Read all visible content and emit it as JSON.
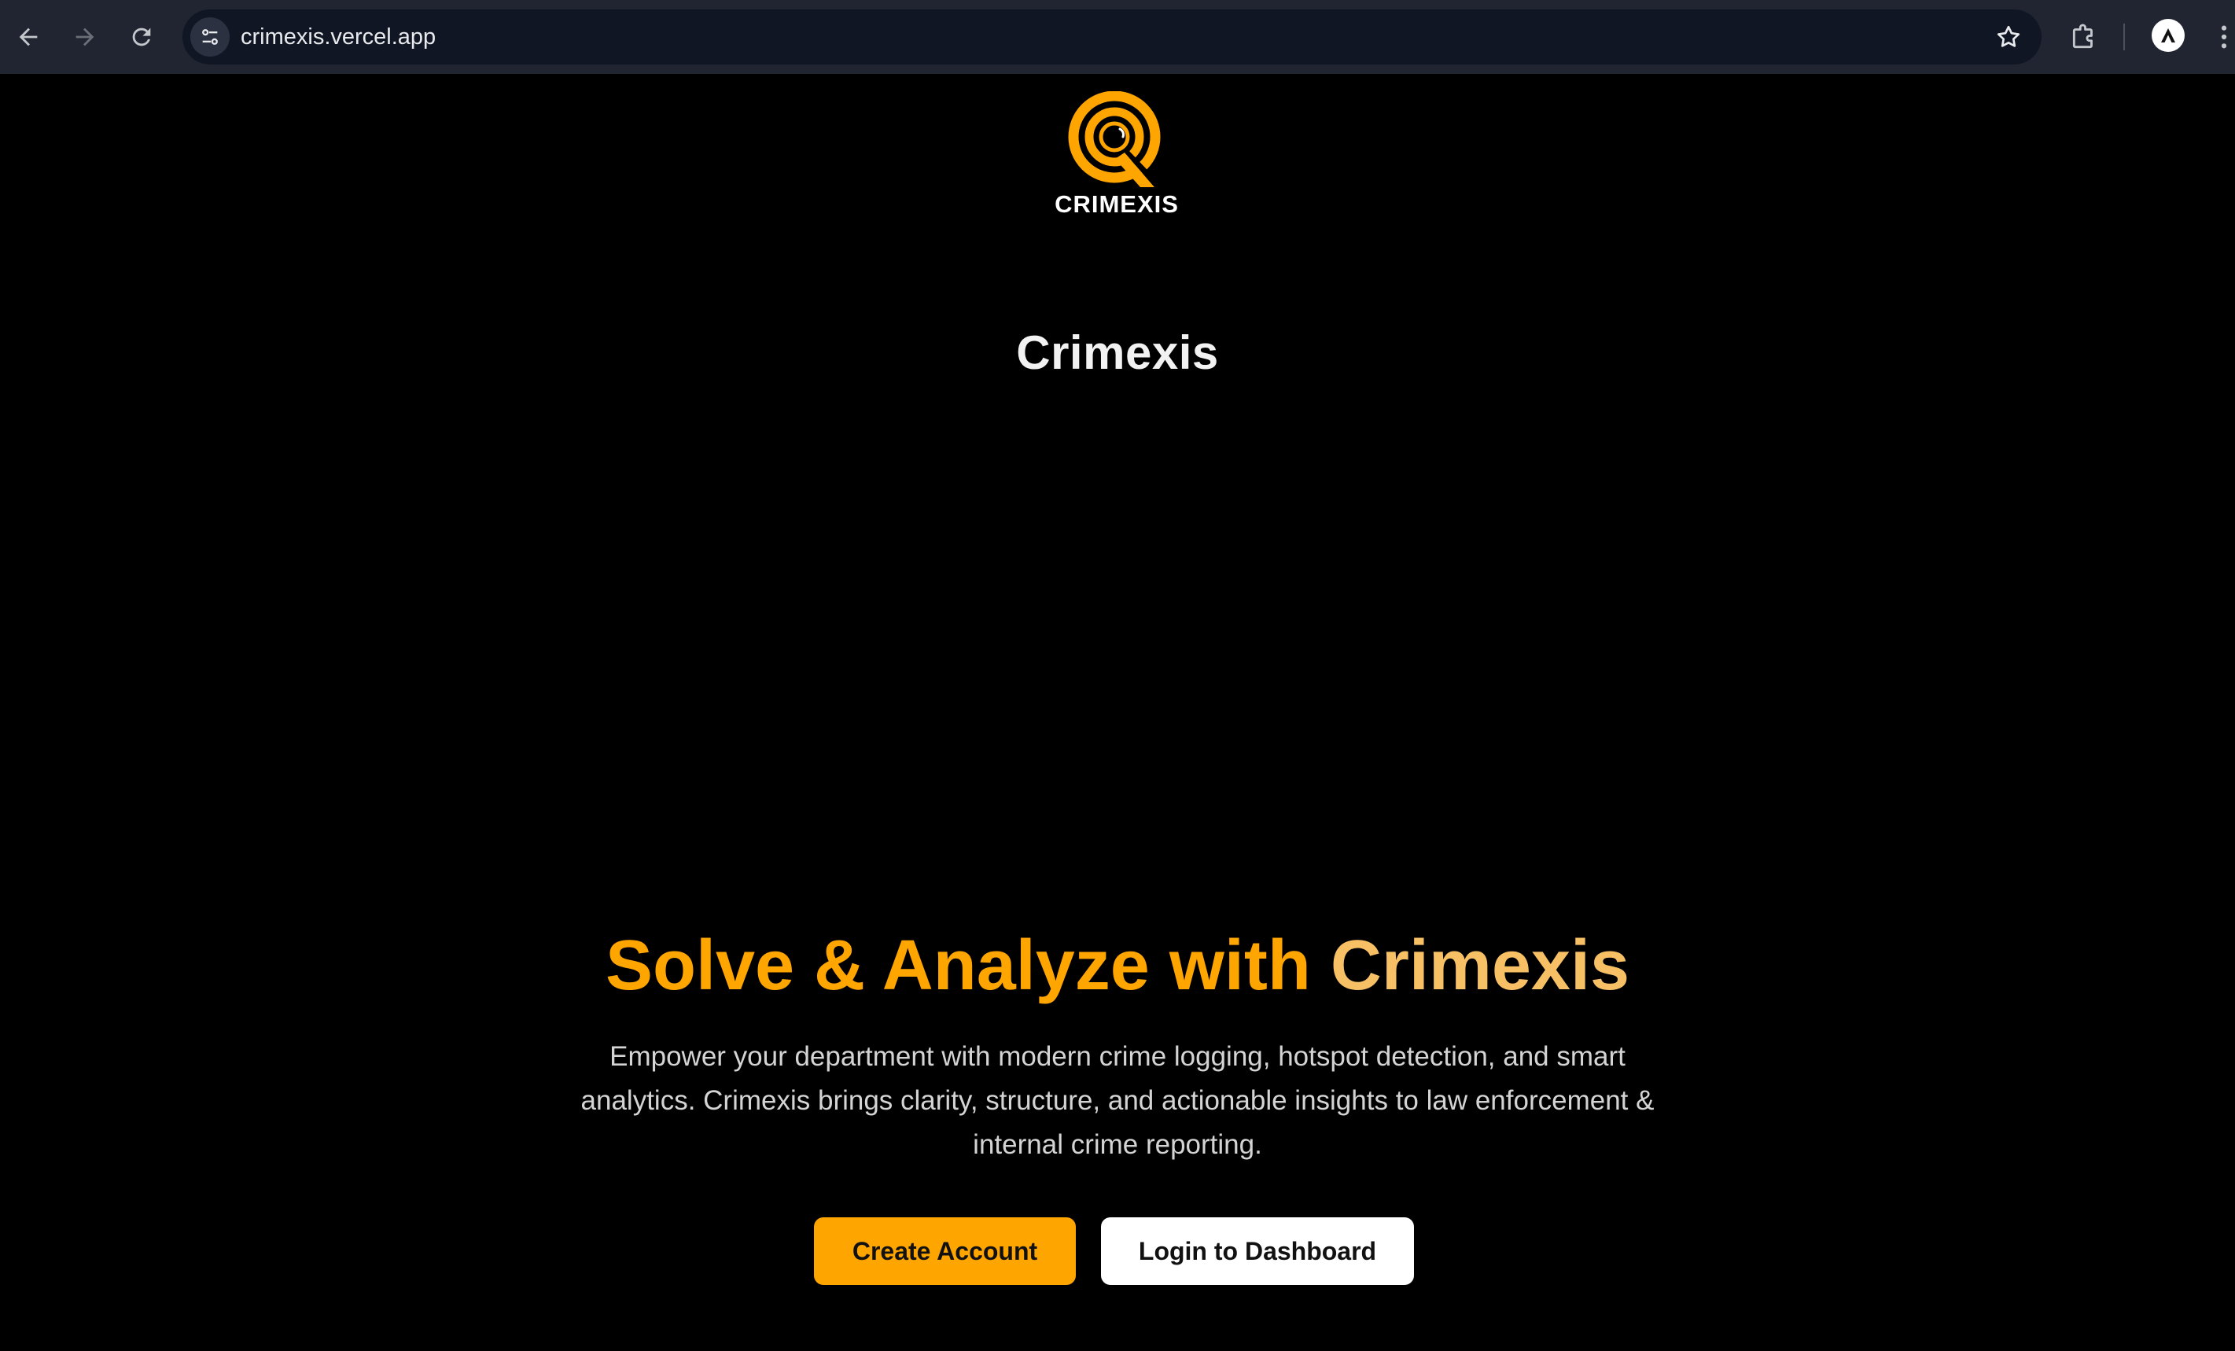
{
  "browser": {
    "url": "crimexis.vercel.app",
    "icons": {
      "back": "back-arrow-icon",
      "forward": "forward-arrow-icon",
      "reload": "reload-icon",
      "site_info": "tune-icon",
      "bookmark": "star-icon",
      "extensions": "puzzle-icon",
      "profile": "profile-avatar",
      "menu": "kebab-menu-icon"
    }
  },
  "brand": {
    "logo_text": "CRIMEXIS",
    "accent_color": "#ffa500"
  },
  "page": {
    "title": "Crimexis",
    "hero": {
      "heading_part1": "Solve & Analyze with ",
      "heading_part2": "Crimexis",
      "description": "Empower your department with modern crime logging, hotspot detection, and smart analytics. Crimexis brings clarity, structure, and actionable insights to law enforcement & internal crime reporting."
    },
    "buttons": {
      "create_account": "Create Account",
      "login_dashboard": "Login to Dashboard"
    }
  },
  "colors": {
    "chrome_bg": "#202531",
    "omnibox_bg": "#101623",
    "page_bg": "#000000",
    "accent": "#ffa500",
    "accent_light": "#f7c065"
  }
}
